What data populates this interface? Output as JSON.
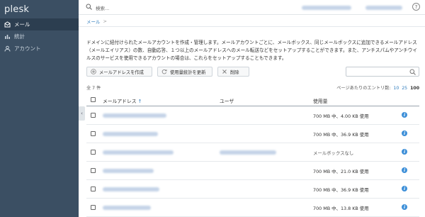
{
  "app": {
    "logo": "plesk"
  },
  "sidebar": {
    "items": [
      {
        "label": "メール",
        "icon": "mail-icon",
        "active": true
      },
      {
        "label": "統計",
        "icon": "bar-chart-icon",
        "active": false
      },
      {
        "label": "アカウント",
        "icon": "user-icon",
        "active": false
      }
    ],
    "collapse_icon": "chevron-left-icon"
  },
  "topbar": {
    "search_placeholder": "検索...",
    "help": "?"
  },
  "breadcrumb": {
    "current": "メール",
    "separator": ">"
  },
  "page": {
    "description": "ドメインに紐付けられたメールアカウントを作成・管理します。メールアカウントごとに、メールボックス、同じメールボックスに追加できるメールアドレス（メールエイリアス）の数、自動応答、１つ以上のメールアドレスへのメール転送などをセットアップすることができます。また、アンチスパムやアンチウイルスのサービスを使用できるアカウントの場合は、これらをセットアップすることもできます。"
  },
  "toolbar": {
    "create_label": "メールアドレスを作成",
    "update_label": "使用量統計を更新",
    "delete_label": "削除"
  },
  "list": {
    "total_label": "全 7 件",
    "per_page_label": "ページあたりのエントリ数:",
    "per_page_options": [
      "10",
      "25",
      "100"
    ],
    "per_page_selected": "100",
    "columns": {
      "email": "メールアドレス",
      "user": "ユーザ",
      "usage": "使用量"
    },
    "sort_indicator": "↑",
    "rows": [
      {
        "usage": "700 MB 中、4.00 KB 使用",
        "has_user": false,
        "email_w": 90
      },
      {
        "usage": "700 MB 中、36.9 KB 使用",
        "has_user": false,
        "email_w": 78
      },
      {
        "usage": "メールボックスなし",
        "has_user": true,
        "email_w": 100
      },
      {
        "usage": "700 MB 中、21.0 KB 使用",
        "has_user": false,
        "email_w": 72
      },
      {
        "usage": "700 MB 中、36.9 KB 使用",
        "has_user": false,
        "email_w": 80
      },
      {
        "usage": "700 MB 中、13.8 KB 使用",
        "has_user": false,
        "email_w": 68
      }
    ],
    "info_icon": "i"
  },
  "colors": {
    "sidebar_bg": "#3b4f63",
    "sidebar_active": "#2c3e50",
    "link": "#2e7bbd",
    "info": "#3d8fd8"
  }
}
